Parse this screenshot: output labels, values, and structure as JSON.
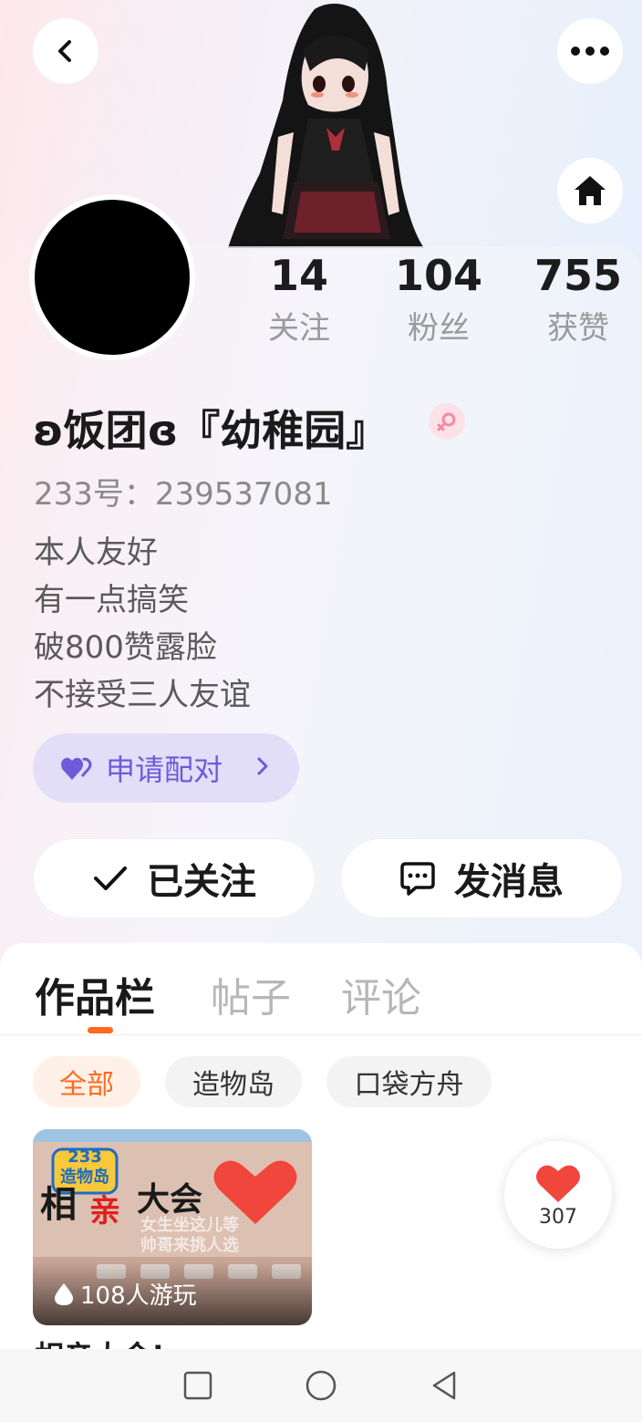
{
  "header": {
    "back_icon": "chevron-left-icon",
    "more_icon": "more-dots-icon",
    "home_icon": "home-icon"
  },
  "stats": [
    {
      "value": "14",
      "label": "关注"
    },
    {
      "value": "104",
      "label": "粉丝"
    },
    {
      "value": "755",
      "label": "获赞"
    }
  ],
  "profile": {
    "name": "ʚ饭团ɞ『幼稚园』",
    "gender_icon": "female-icon",
    "uid": "233号：239537081",
    "bio": [
      "本人友好",
      "有一点搞笑",
      "破800赞露脸",
      "不接受三人友谊"
    ]
  },
  "match_button": {
    "label": "申请配对"
  },
  "actions": {
    "follow_label": "已关注",
    "message_label": "发消息"
  },
  "tabs": [
    {
      "label": "作品栏",
      "active": true
    },
    {
      "label": "帖子",
      "active": false
    },
    {
      "label": "评论",
      "active": false
    }
  ],
  "filters": [
    {
      "label": "全部",
      "active": true
    },
    {
      "label": "造物岛",
      "active": false
    },
    {
      "label": "口袋方舟",
      "active": false
    }
  ],
  "card": {
    "logo_text": "233\n造物岛",
    "thumb_title_left": "相",
    "thumb_title_red": "亲",
    "thumb_title_right": "大会",
    "thumb_caption_1": "女生坐这儿等",
    "thumb_caption_2": "帅哥来挑人选",
    "plays": "108人游玩",
    "title": "相亲大会!"
  },
  "like_float": {
    "count": "307"
  },
  "colors": {
    "accent": "#ff6a1f",
    "match": "#6f5ad9",
    "heart": "#f0463c"
  }
}
